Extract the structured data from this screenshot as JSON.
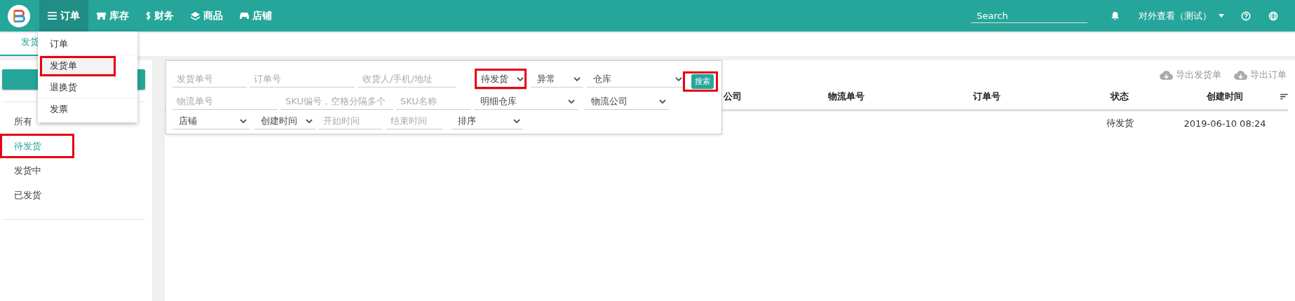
{
  "top_nav": {
    "items": [
      {
        "label": "订单",
        "selected": true
      },
      {
        "label": "库存",
        "selected": false
      },
      {
        "label": "财务",
        "selected": false
      },
      {
        "label": "商品",
        "selected": false
      },
      {
        "label": "店铺",
        "selected": false
      }
    ]
  },
  "search": {
    "placeholder": "Search"
  },
  "user_menu": {
    "label": "对外查看（测试）"
  },
  "page_tab": {
    "label": "发货",
    "selected": true
  },
  "order_menu": {
    "items": [
      {
        "label": "订单",
        "selected": false,
        "highlighted": false
      },
      {
        "label": "发货单",
        "selected": true,
        "highlighted": true
      },
      {
        "label": "退换货",
        "selected": false,
        "highlighted": false
      },
      {
        "label": "发票",
        "selected": false,
        "highlighted": false
      }
    ]
  },
  "sidebar": {
    "items": [
      {
        "label": "所有",
        "selected": false,
        "highlighted": false
      },
      {
        "label": "待发货",
        "selected": true,
        "highlighted": true
      },
      {
        "label": "发货中",
        "selected": false,
        "highlighted": false
      },
      {
        "label": "已发货",
        "selected": false,
        "highlighted": false
      }
    ]
  },
  "filters": {
    "fields": [
      {
        "kind": "input",
        "placeholder": "发货单号"
      },
      {
        "kind": "input",
        "placeholder": "订单号"
      },
      {
        "kind": "input",
        "placeholder": "收货人/手机/地址"
      },
      {
        "kind": "select",
        "value": "待发货",
        "highlighted": true
      },
      {
        "kind": "select",
        "value": "异常",
        "highlighted": false
      },
      {
        "kind": "select",
        "value": "仓库",
        "highlighted": false
      },
      {
        "kind": "input",
        "placeholder": "物流单号"
      },
      {
        "kind": "input",
        "placeholder": "SKU编号，空格分隔多个"
      },
      {
        "kind": "input",
        "placeholder": "SKU名称"
      },
      {
        "kind": "select",
        "value": "明细仓库",
        "highlighted": false
      },
      {
        "kind": "select",
        "value": "物流公司",
        "highlighted": false
      },
      {
        "kind": "select",
        "value": "店铺",
        "highlighted": false
      },
      {
        "kind": "select",
        "value": "创建时间",
        "highlighted": false
      },
      {
        "kind": "input",
        "placeholder": "开始时间"
      },
      {
        "kind": "input",
        "placeholder": "结束时间"
      },
      {
        "kind": "select",
        "value": "排序",
        "highlighted": false
      }
    ],
    "search_button": {
      "label": "搜索",
      "highlighted": true
    }
  },
  "exports": [
    {
      "label": "导出发货单"
    },
    {
      "label": "导出订单"
    }
  ],
  "table": {
    "columns": [
      "公司",
      "物流单号",
      "订单号",
      "状态",
      "创建时间"
    ],
    "rows": [
      {
        "status": "待发货",
        "created": "2019-06-10 08:24"
      }
    ]
  }
}
